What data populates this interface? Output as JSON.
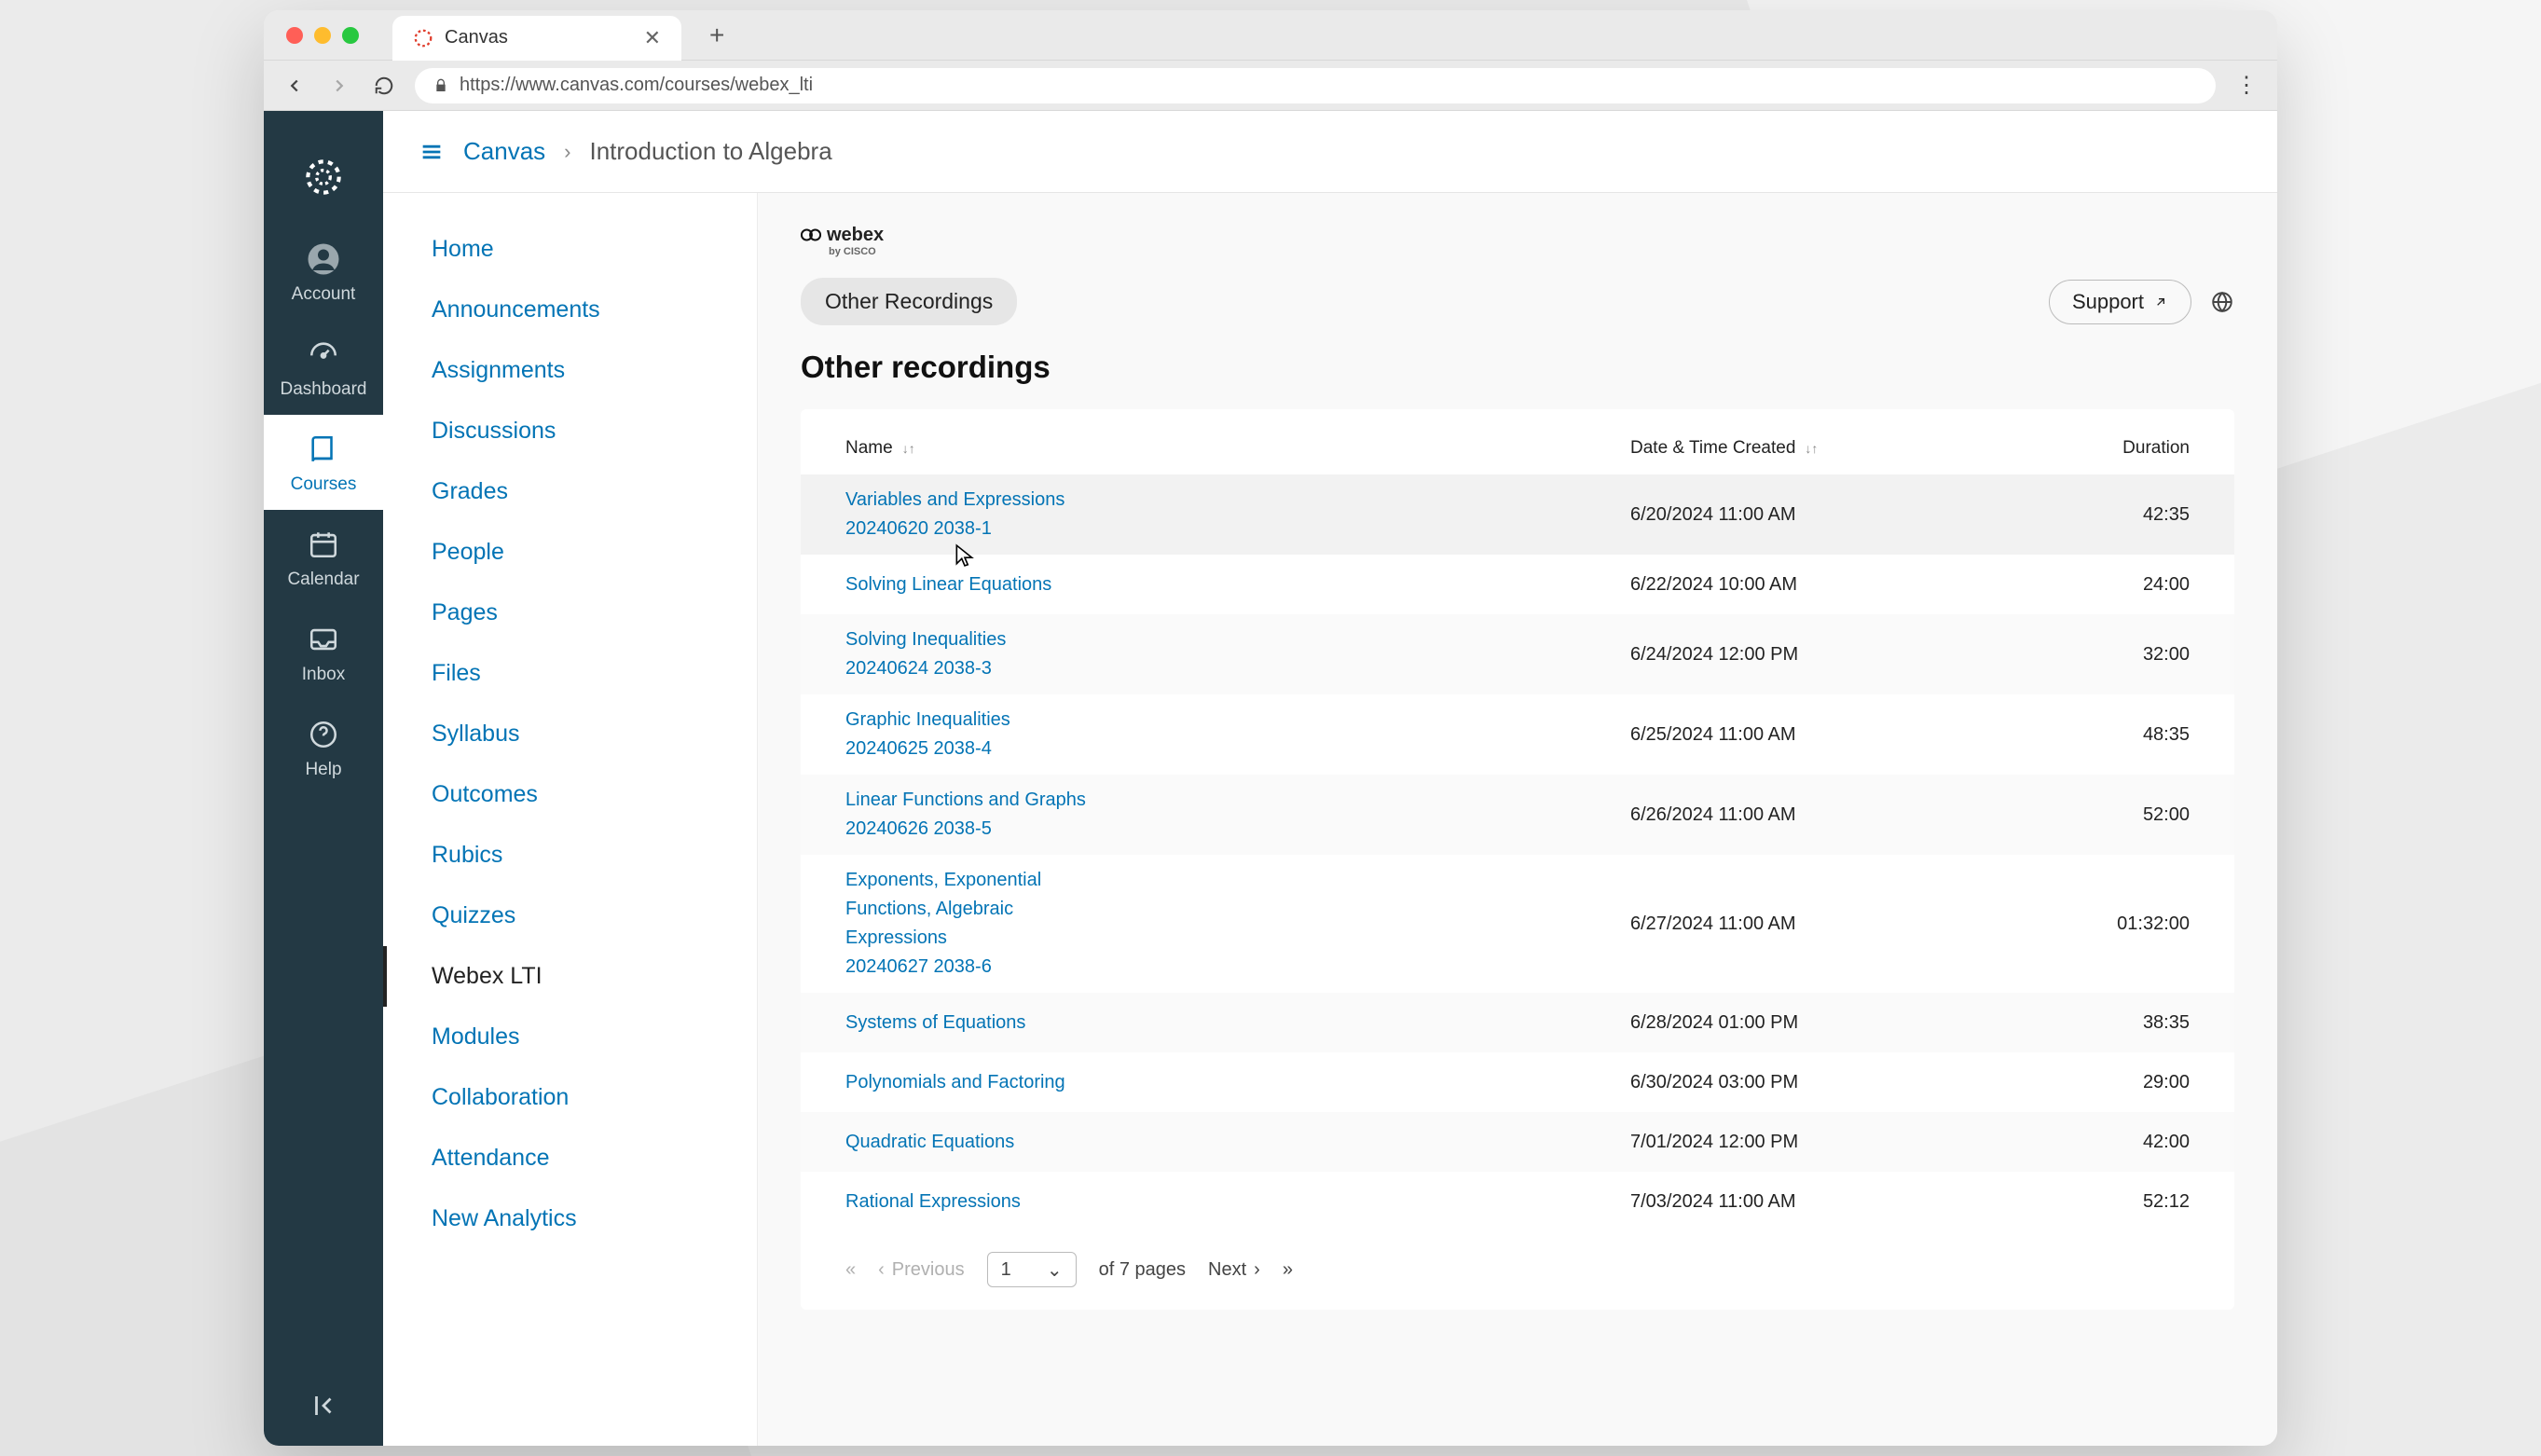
{
  "browser": {
    "tab_title": "Canvas",
    "url": "https://www.canvas.com/courses/webex_lti"
  },
  "globalnav": {
    "items": [
      {
        "label": "Account"
      },
      {
        "label": "Dashboard"
      },
      {
        "label": "Courses"
      },
      {
        "label": "Calendar"
      },
      {
        "label": "Inbox"
      },
      {
        "label": "Help"
      }
    ]
  },
  "breadcrumb": {
    "root": "Canvas",
    "course": "Introduction to Algebra"
  },
  "coursenav": [
    "Home",
    "Announcements",
    "Assignments",
    "Discussions",
    "Grades",
    "People",
    "Pages",
    "Files",
    "Syllabus",
    "Outcomes",
    "Rubics",
    "Quizzes",
    "Webex LTI",
    "Modules",
    "Collaboration",
    "Attendance",
    "New Analytics"
  ],
  "brand": {
    "name": "webex",
    "sub": "by CISCO"
  },
  "pill": "Other Recordings",
  "support_label": "Support",
  "page_title": "Other recordings",
  "columns": {
    "name": "Name",
    "date": "Date & Time Created",
    "duration": "Duration"
  },
  "rows": [
    {
      "name": "Variables and Expressions\n20240620 2038-1",
      "date": "6/20/2024 11:00 AM",
      "dur": "42:35",
      "hover": true
    },
    {
      "name": "Solving Linear Equations",
      "date": "6/22/2024 10:00 AM",
      "dur": "24:00"
    },
    {
      "name": "Solving Inequalities\n20240624 2038-3",
      "date": "6/24/2024 12:00 PM",
      "dur": "32:00"
    },
    {
      "name": "Graphic Inequalities\n20240625 2038-4",
      "date": "6/25/2024 11:00 AM",
      "dur": "48:35"
    },
    {
      "name": "Linear Functions and Graphs\n20240626 2038-5",
      "date": "6/26/2024 11:00 AM",
      "dur": "52:00"
    },
    {
      "name": "Exponents, Exponential Functions, Algebraic Expressions\n20240627 2038-6",
      "date": "6/27/2024 11:00 AM",
      "dur": "01:32:00"
    },
    {
      "name": "Systems of Equations",
      "date": "6/28/2024 01:00 PM",
      "dur": "38:35"
    },
    {
      "name": "Polynomials and Factoring",
      "date": "6/30/2024 03:00 PM",
      "dur": "29:00"
    },
    {
      "name": "Quadratic Equations",
      "date": "7/01/2024 12:00 PM",
      "dur": "42:00"
    },
    {
      "name": "Rational Expressions",
      "date": "7/03/2024 11:00 AM",
      "dur": "52:12"
    }
  ],
  "pager": {
    "prev": "Previous",
    "next": "Next",
    "page": "1",
    "of_text": "of 7 pages"
  }
}
